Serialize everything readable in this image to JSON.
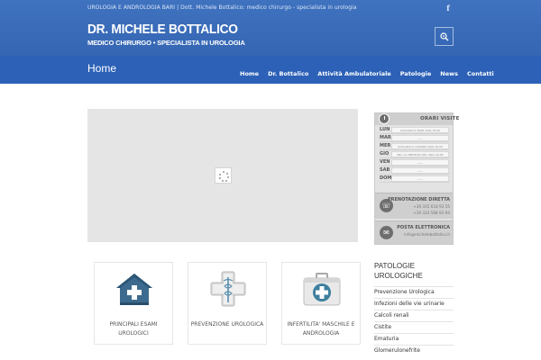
{
  "header": {
    "tagline": "UROLOGIA E ANDROLOGIA BARI | Dott. Michele Bottalico: medico chirurgo - specialista in urologia",
    "logo_line1": "DR. MICHELE BOTTALICO",
    "logo_line2": "MEDICO CHIRURGO • SPECIALISTA IN UROLOGIA",
    "social_icon": "facebook-icon",
    "search_icon": "search-icon"
  },
  "navbar": {
    "page_title": "Home",
    "items": [
      "Home",
      "Dr. Bottalico",
      "Attività Ambulatoriale",
      "Patologie",
      "News",
      "Contatti"
    ]
  },
  "hours_widget": {
    "title": "ORARI VISITE",
    "days": [
      {
        "day": "LUN",
        "slot": "Ambulatorio BARI dalle 15:00"
      },
      {
        "day": "MAR",
        "slot": "------"
      },
      {
        "day": "MER",
        "slot": "Ambulatorio CASAMA dalle 16:00"
      },
      {
        "day": "GIO",
        "slot": "Bari c/o MEDICOS DEL dalle 16:00"
      },
      {
        "day": "VEN",
        "slot": "------"
      },
      {
        "day": "SAB",
        "slot": "------"
      },
      {
        "day": "DOM",
        "slot": "------"
      }
    ],
    "booking_title": "PRENOTAZIONE DIRETTA",
    "phones": [
      "+39 335 618 93 55",
      "+39 333 568 93 94"
    ],
    "email_title": "POSTA ELETTRONICA",
    "email": "info@michelebottalico.it"
  },
  "feature_boxes": [
    {
      "label": "PRINCIPALI ESAMI UROLOGICI",
      "icon": "house-medical-icon"
    },
    {
      "label": "PREVENZIONE UROLOGICA",
      "icon": "caduceus-cross-icon"
    },
    {
      "label": "INFERTILITA' MASCHILE E ANDROLOGIA",
      "icon": "first-aid-kit-icon"
    }
  ],
  "sidebar": {
    "title": "PATOLOGIE UROLOGICHE",
    "items": [
      "Prevenzione Urologica",
      "Infezioni delle vie urinarie",
      "Calcoli renali",
      "Cistite",
      "Ematuria",
      "Glomerulonefrite"
    ]
  },
  "colors": {
    "header_blue": "#3f72bf",
    "nav_blue": "#2c61b7"
  }
}
